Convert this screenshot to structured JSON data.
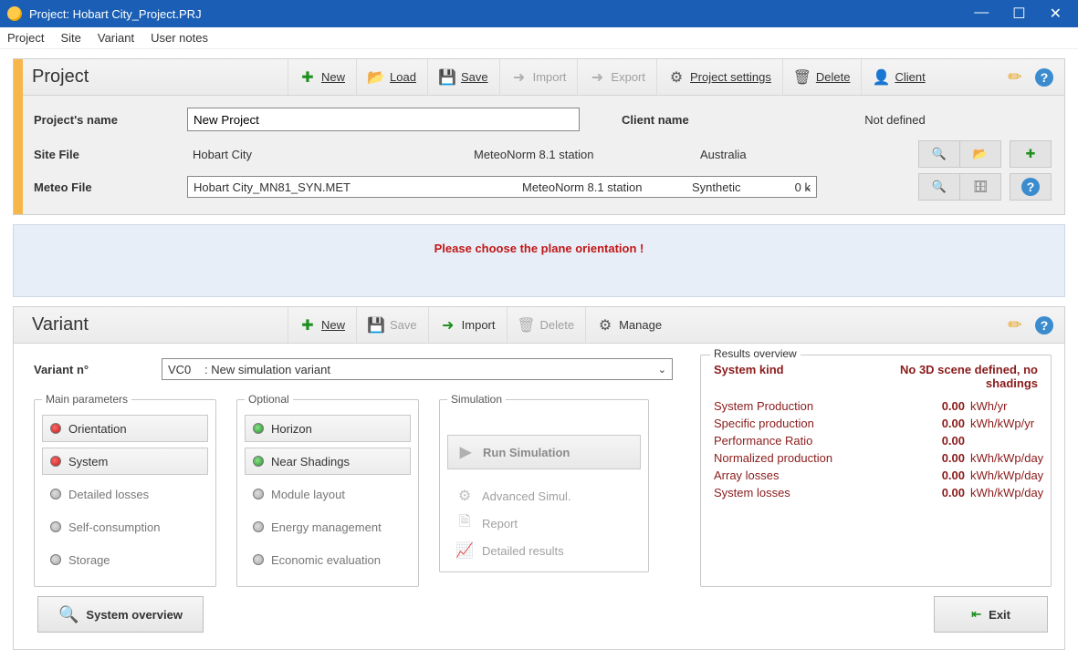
{
  "window": {
    "title": "Project:  Hobart City_Project.PRJ"
  },
  "menubar": [
    "Project",
    "Site",
    "Variant",
    "User notes"
  ],
  "project": {
    "title": "Project",
    "toolbar": {
      "new": "New",
      "load": "Load",
      "save": "Save",
      "import": "Import",
      "export": "Export",
      "settings": "Project settings",
      "delete": "Delete",
      "client": "Client"
    },
    "rows": {
      "name_label": "Project's name",
      "name_value": "New Project",
      "client_label": "Client name",
      "client_value": "Not defined",
      "site_label": "Site File",
      "site_name": "Hobart City",
      "site_source": "MeteoNorm 8.1 station",
      "site_country": "Australia",
      "meteo_label": "Meteo File",
      "meteo_name": "Hobart City_MN81_SYN.MET",
      "meteo_source": "MeteoNorm 8.1 station",
      "meteo_kind": "Synthetic",
      "meteo_dist": "0 k"
    }
  },
  "alert": "Please choose the plane orientation !",
  "variant": {
    "title": "Variant",
    "toolbar": {
      "new": "New",
      "save": "Save",
      "import": "Import",
      "delete": "Delete",
      "manage": "Manage"
    },
    "selector": {
      "label": "Variant n°",
      "code": "VC0",
      "text": ": New simulation variant"
    },
    "groups": {
      "main_title": "Main parameters",
      "optional_title": "Optional",
      "sim_title": "Simulation",
      "main": [
        {
          "label": "Orientation",
          "dot": "red",
          "flat": false
        },
        {
          "label": "System",
          "dot": "red",
          "flat": false
        },
        {
          "label": "Detailed losses",
          "dot": "grey",
          "flat": true
        },
        {
          "label": "Self-consumption",
          "dot": "grey",
          "flat": true
        },
        {
          "label": "Storage",
          "dot": "grey",
          "flat": true
        }
      ],
      "optional": [
        {
          "label": "Horizon",
          "dot": "green",
          "flat": false
        },
        {
          "label": "Near Shadings",
          "dot": "green",
          "flat": false
        },
        {
          "label": "Module layout",
          "dot": "grey",
          "flat": true
        },
        {
          "label": "Energy management",
          "dot": "grey",
          "flat": true
        },
        {
          "label": "Economic evaluation",
          "dot": "grey",
          "flat": true
        }
      ],
      "sim": {
        "run": "Run Simulation",
        "adv": "Advanced Simul.",
        "report": "Report",
        "detailed": "Detailed results"
      }
    },
    "results": {
      "legend": "Results overview",
      "heading_left": "System kind",
      "heading_right": "No 3D scene defined, no shadings",
      "rows": [
        {
          "k": "System Production",
          "v": "0.00",
          "u": "kWh/yr"
        },
        {
          "k": "Specific production",
          "v": "0.00",
          "u": "kWh/kWp/yr"
        },
        {
          "k": "Performance Ratio",
          "v": "0.00",
          "u": ""
        },
        {
          "k": "Normalized production",
          "v": "0.00",
          "u": "kWh/kWp/day"
        },
        {
          "k": "Array losses",
          "v": "0.00",
          "u": "kWh/kWp/day"
        },
        {
          "k": "System losses",
          "v": "0.00",
          "u": "kWh/kWp/day"
        }
      ]
    }
  },
  "footer": {
    "overview": "System overview",
    "exit": "Exit"
  }
}
